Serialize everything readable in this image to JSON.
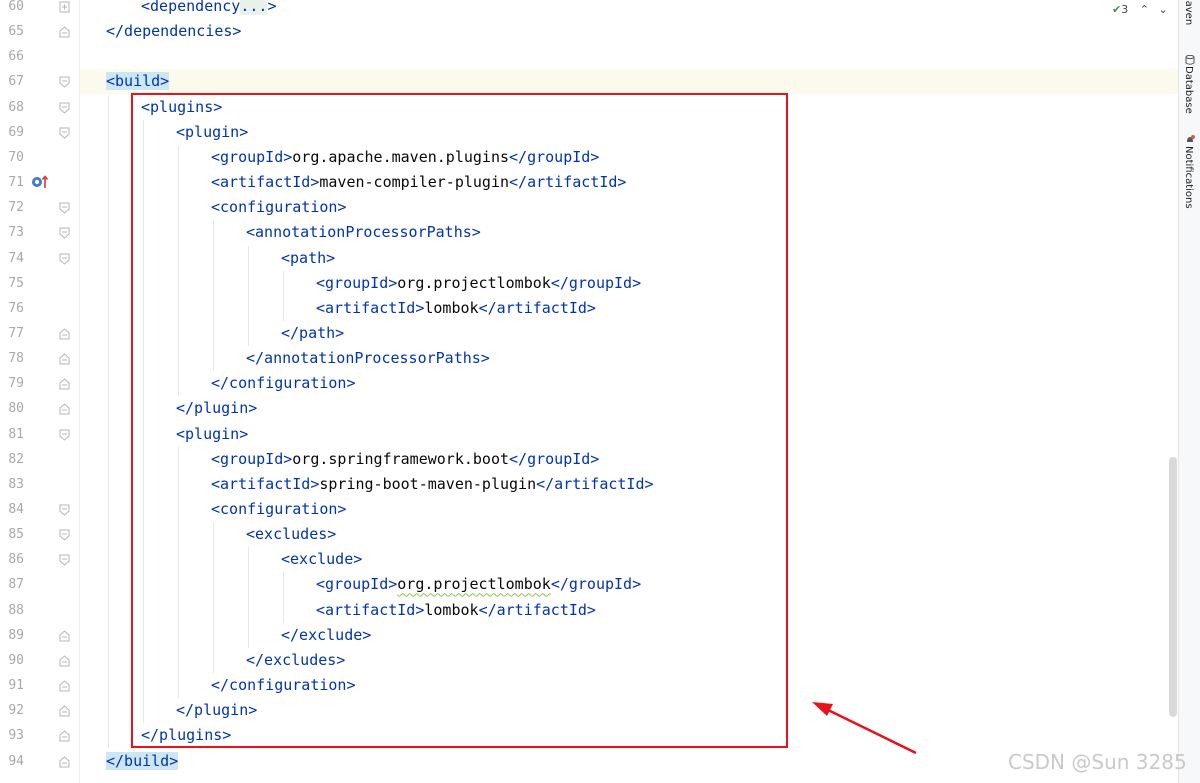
{
  "gutter": {
    "line_numbers": [
      "60",
      "65",
      "66",
      "67",
      "68",
      "69",
      "70",
      "71",
      "72",
      "73",
      "74",
      "75",
      "76",
      "77",
      "78",
      "79",
      "80",
      "81",
      "82",
      "83",
      "84",
      "85",
      "86",
      "87",
      "88",
      "89",
      "90",
      "91",
      "92",
      "93",
      "94"
    ]
  },
  "code_lines": [
    {
      "num": "60",
      "indent": 1,
      "parts": [
        {
          "c": "tag",
          "t": "<dependency"
        },
        {
          "c": "fold",
          "t": "..."
        },
        {
          "c": "tag",
          "t": ">"
        }
      ]
    },
    {
      "num": "65",
      "indent": 0,
      "parts": [
        {
          "c": "tag",
          "t": "</dependencies>"
        }
      ]
    },
    {
      "num": "66",
      "indent": 0,
      "parts": []
    },
    {
      "num": "67",
      "indent": 0,
      "parts": [
        {
          "c": "build",
          "t": "<build>"
        }
      ]
    },
    {
      "num": "68",
      "indent": 1,
      "parts": [
        {
          "c": "tag",
          "t": "<plugins>"
        }
      ]
    },
    {
      "num": "69",
      "indent": 2,
      "parts": [
        {
          "c": "tag",
          "t": "<plugin>"
        }
      ]
    },
    {
      "num": "70",
      "indent": 3,
      "parts": [
        {
          "c": "tag",
          "t": "<groupId>"
        },
        {
          "c": "txt",
          "t": "org.apache.maven.plugins"
        },
        {
          "c": "tag",
          "t": "</groupId>"
        }
      ]
    },
    {
      "num": "71",
      "indent": 3,
      "parts": [
        {
          "c": "tag",
          "t": "<artifactId>"
        },
        {
          "c": "txt",
          "t": "maven-compiler-plugin"
        },
        {
          "c": "tag",
          "t": "</artifactId>"
        }
      ]
    },
    {
      "num": "72",
      "indent": 3,
      "parts": [
        {
          "c": "tag",
          "t": "<configuration>"
        }
      ]
    },
    {
      "num": "73",
      "indent": 4,
      "parts": [
        {
          "c": "tag",
          "t": "<annotationProcessorPaths>"
        }
      ]
    },
    {
      "num": "74",
      "indent": 5,
      "parts": [
        {
          "c": "tag",
          "t": "<path>"
        }
      ]
    },
    {
      "num": "75",
      "indent": 6,
      "parts": [
        {
          "c": "tag",
          "t": "<groupId>"
        },
        {
          "c": "txt",
          "t": "org.projectlombok"
        },
        {
          "c": "tag",
          "t": "</groupId>"
        }
      ]
    },
    {
      "num": "76",
      "indent": 6,
      "parts": [
        {
          "c": "tag",
          "t": "<artifactId>"
        },
        {
          "c": "txt",
          "t": "lombok"
        },
        {
          "c": "tag",
          "t": "</artifactId>"
        }
      ]
    },
    {
      "num": "77",
      "indent": 5,
      "parts": [
        {
          "c": "tag",
          "t": "</path>"
        }
      ]
    },
    {
      "num": "78",
      "indent": 4,
      "parts": [
        {
          "c": "tag",
          "t": "</annotationProcessorPaths>"
        }
      ]
    },
    {
      "num": "79",
      "indent": 3,
      "parts": [
        {
          "c": "tag",
          "t": "</configuration>"
        }
      ]
    },
    {
      "num": "80",
      "indent": 2,
      "parts": [
        {
          "c": "tag",
          "t": "</plugin>"
        }
      ]
    },
    {
      "num": "81",
      "indent": 2,
      "parts": [
        {
          "c": "tag",
          "t": "<plugin>"
        }
      ]
    },
    {
      "num": "82",
      "indent": 3,
      "parts": [
        {
          "c": "tag",
          "t": "<groupId>"
        },
        {
          "c": "txt",
          "t": "org.springframework.boot"
        },
        {
          "c": "tag",
          "t": "</groupId>"
        }
      ]
    },
    {
      "num": "83",
      "indent": 3,
      "parts": [
        {
          "c": "tag",
          "t": "<artifactId>"
        },
        {
          "c": "txt",
          "t": "spring-boot-maven-plugin"
        },
        {
          "c": "tag",
          "t": "</artifactId>"
        }
      ]
    },
    {
      "num": "84",
      "indent": 3,
      "parts": [
        {
          "c": "tag",
          "t": "<configuration>"
        }
      ]
    },
    {
      "num": "85",
      "indent": 4,
      "parts": [
        {
          "c": "tag",
          "t": "<excludes>"
        }
      ]
    },
    {
      "num": "86",
      "indent": 5,
      "parts": [
        {
          "c": "tag",
          "t": "<exclude>"
        }
      ]
    },
    {
      "num": "87",
      "indent": 6,
      "parts": [
        {
          "c": "tag",
          "t": "<groupId>"
        },
        {
          "c": "typo",
          "t": "org.projectlombok"
        },
        {
          "c": "tag",
          "t": "</groupId>"
        }
      ]
    },
    {
      "num": "88",
      "indent": 6,
      "parts": [
        {
          "c": "tag",
          "t": "<artifactId>"
        },
        {
          "c": "txt",
          "t": "lombok"
        },
        {
          "c": "tag",
          "t": "</artifactId>"
        }
      ]
    },
    {
      "num": "89",
      "indent": 5,
      "parts": [
        {
          "c": "tag",
          "t": "</exclude>"
        }
      ]
    },
    {
      "num": "90",
      "indent": 4,
      "parts": [
        {
          "c": "tag",
          "t": "</excludes>"
        }
      ]
    },
    {
      "num": "91",
      "indent": 3,
      "parts": [
        {
          "c": "tag",
          "t": "</configuration>"
        }
      ]
    },
    {
      "num": "92",
      "indent": 2,
      "parts": [
        {
          "c": "tag",
          "t": "</plugin>"
        }
      ]
    },
    {
      "num": "93",
      "indent": 1,
      "parts": [
        {
          "c": "tag",
          "t": "</plugins>"
        }
      ]
    },
    {
      "num": "94",
      "indent": 0,
      "parts": [
        {
          "c": "build",
          "t": "</build>"
        }
      ]
    }
  ],
  "right_toolbar": {
    "tabs": [
      "Maven",
      "Database",
      "Notifications"
    ]
  },
  "inspections": {
    "count": "3",
    "icon": "check-icon"
  },
  "watermark": "CSDN @Sun 3285",
  "colors": {
    "tag": "#0033b3",
    "text": "#080808",
    "highlight_box": "#e8121c",
    "build_highlight": "#cde7f2",
    "current_line": "#fcfaed"
  }
}
